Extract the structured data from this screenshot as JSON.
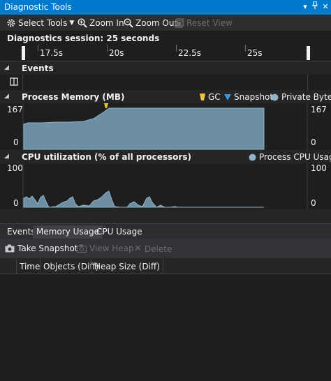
{
  "window": {
    "title": "Diagnostic Tools"
  },
  "toolbar": {
    "select_tools": "Select Tools",
    "zoom_in": "Zoom In",
    "zoom_out": "Zoom Out",
    "reset_view": "Reset View"
  },
  "session": {
    "label": "Diagnostics session: 25 seconds"
  },
  "ruler": {
    "ticks": [
      "17.5s",
      "20s",
      "22.5s",
      "25s"
    ]
  },
  "events": {
    "title": "Events"
  },
  "memory": {
    "title": "Process Memory (MB)",
    "legend": {
      "gc": "GC",
      "snapshot": "Snapshot",
      "private_bytes": "Private Bytes"
    },
    "y_max_left": "167",
    "y_min_left": "0",
    "y_max_right": "167",
    "y_min_right": "0",
    "colors": {
      "gc": "#f5c542",
      "snapshot": "#3a96dd",
      "private_bytes": "#8fb4c9",
      "fill": "#6d8ea3"
    }
  },
  "cpu": {
    "title": "CPU utilization (% of all processors)",
    "legend": {
      "process_cpu": "Process CPU Usage"
    },
    "y_max_left": "100",
    "y_min_left": "0",
    "y_max_right": "100",
    "y_min_right": "0"
  },
  "bottom_tabs": [
    "Events",
    "Memory Usage",
    "CPU Usage"
  ],
  "memory_toolbar": {
    "take_snapshot": "Take Snapshot",
    "view_heap": "View Heap",
    "delete": "Delete"
  },
  "grid": {
    "columns": [
      "Time",
      "Objects (Diff)",
      "Heap Size (Diff)"
    ]
  },
  "icons": [
    "pin-icon",
    "close-icon",
    "gear-icon",
    "zoom-in-icon",
    "zoom-out-icon",
    "reset-view-icon",
    "camera-icon",
    "view-heap-icon",
    "delete-icon",
    "pause-icon"
  ]
}
